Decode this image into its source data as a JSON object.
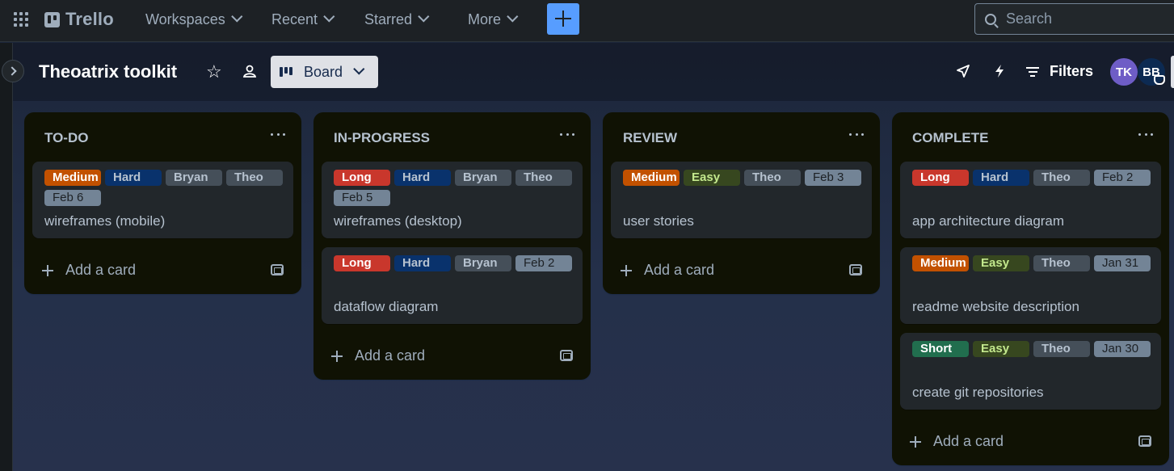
{
  "topbar": {
    "app_name": "Trello",
    "nav": [
      "Workspaces",
      "Recent",
      "Starred",
      "More"
    ],
    "search_placeholder": "Search"
  },
  "board": {
    "title": "Theoatrix toolkit",
    "view_label": "Board",
    "filters_label": "Filters",
    "members": [
      "TK",
      "BB"
    ]
  },
  "colors": {
    "Medium": "#c25100",
    "Long": "#c9372c",
    "Hard": "#09326c",
    "Easy": "#37471f",
    "Short": "#216e4e",
    "member": "#454f59"
  },
  "lists": [
    {
      "title": "TO-DO",
      "add_card": "Add a card",
      "cards": [
        {
          "labels": [
            "Medium",
            "Hard",
            "Bryan",
            "Theo"
          ],
          "date": "Feb 6",
          "title": "wireframes (mobile)"
        }
      ]
    },
    {
      "title": "IN-PROGRESS",
      "add_card": "Add a card",
      "cards": [
        {
          "labels": [
            "Long",
            "Hard",
            "Bryan",
            "Theo"
          ],
          "date": "Feb 5",
          "title": "wireframes (desktop)"
        },
        {
          "labels": [
            "Long",
            "Hard",
            "Bryan"
          ],
          "date": "Feb 2",
          "title": "dataflow diagram"
        }
      ]
    },
    {
      "title": "REVIEW",
      "add_card": "Add a card",
      "cards": [
        {
          "labels": [
            "Medium",
            "Easy",
            "Theo"
          ],
          "date": "Feb 3",
          "title": "user stories"
        }
      ]
    },
    {
      "title": "COMPLETE",
      "add_card": "Add a card",
      "cards": [
        {
          "labels": [
            "Long",
            "Hard",
            "Theo"
          ],
          "date": "Feb 2",
          "title": "app architecture diagram"
        },
        {
          "labels": [
            "Medium",
            "Easy",
            "Theo"
          ],
          "date": "Jan 31",
          "title": "readme website description"
        },
        {
          "labels": [
            "Short",
            "Easy",
            "Theo"
          ],
          "date": "Jan 30",
          "title": "create git repositories"
        }
      ]
    }
  ]
}
